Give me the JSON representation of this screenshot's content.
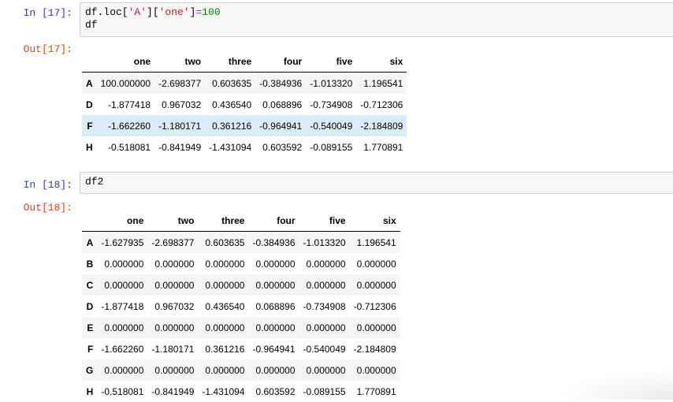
{
  "cell17": {
    "in_prompt": "In [17]:",
    "code_line1": {
      "a": "df.loc[",
      "s1": "'A'",
      "b": "][",
      "s2": "'one'",
      "c": "]",
      "op": "=",
      "num": "100"
    },
    "code_line2": "df",
    "out_prompt": "Out[17]:",
    "table": {
      "columns": [
        "",
        "one",
        "two",
        "three",
        "four",
        "five",
        "six"
      ],
      "rows": [
        {
          "index": "A",
          "values": [
            "100.000000",
            "-2.698377",
            "0.603635",
            "-0.384936",
            "-1.013320",
            "1.196541"
          ]
        },
        {
          "index": "D",
          "values": [
            "-1.877418",
            "0.967032",
            "0.436540",
            "0.068896",
            "-0.734908",
            "-0.712306"
          ]
        },
        {
          "index": "F",
          "values": [
            "-1.662260",
            "-1.180171",
            "0.361216",
            "-0.964941",
            "-0.540049",
            "-2.184809"
          ]
        },
        {
          "index": "H",
          "values": [
            "-0.518081",
            "-0.841949",
            "-1.431094",
            "0.603592",
            "-0.089155",
            "1.770891"
          ]
        }
      ]
    }
  },
  "cell18": {
    "in_prompt": "In [18]:",
    "code_line1": "df2",
    "out_prompt": "Out[18]:",
    "table": {
      "columns": [
        "",
        "one",
        "two",
        "three",
        "four",
        "five",
        "six"
      ],
      "rows": [
        {
          "index": "A",
          "values": [
            "-1.627935",
            "-2.698377",
            "0.603635",
            "-0.384936",
            "-1.013320",
            "1.196541"
          ]
        },
        {
          "index": "B",
          "values": [
            "0.000000",
            "0.000000",
            "0.000000",
            "0.000000",
            "0.000000",
            "0.000000"
          ]
        },
        {
          "index": "C",
          "values": [
            "0.000000",
            "0.000000",
            "0.000000",
            "0.000000",
            "0.000000",
            "0.000000"
          ]
        },
        {
          "index": "D",
          "values": [
            "-1.877418",
            "0.967032",
            "0.436540",
            "0.068896",
            "-0.734908",
            "-0.712306"
          ]
        },
        {
          "index": "E",
          "values": [
            "0.000000",
            "0.000000",
            "0.000000",
            "0.000000",
            "0.000000",
            "0.000000"
          ]
        },
        {
          "index": "F",
          "values": [
            "-1.662260",
            "-1.180171",
            "0.361216",
            "-0.964941",
            "-0.540049",
            "-2.184809"
          ]
        },
        {
          "index": "G",
          "values": [
            "0.000000",
            "0.000000",
            "0.000000",
            "0.000000",
            "0.000000",
            "0.000000"
          ]
        },
        {
          "index": "H",
          "values": [
            "-0.518081",
            "-0.841949",
            "-1.431094",
            "0.603592",
            "-0.089155",
            "1.770891"
          ]
        }
      ]
    }
  }
}
